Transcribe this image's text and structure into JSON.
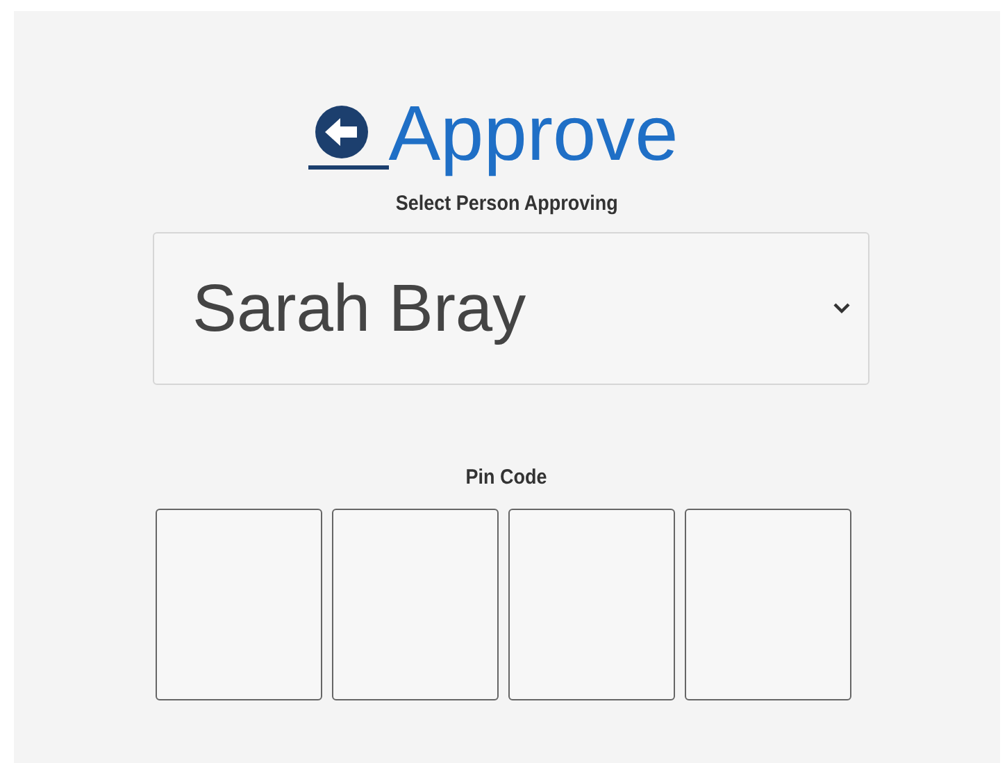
{
  "header": {
    "title": "Approve"
  },
  "approver": {
    "label": "Select Person Approving",
    "value": "Sarah Bray"
  },
  "pin": {
    "label": "Pin Code",
    "digits": [
      {
        "kind": "box"
      },
      {
        "kind": "box"
      },
      {
        "kind": "box"
      },
      {
        "kind": "box"
      }
    ]
  }
}
